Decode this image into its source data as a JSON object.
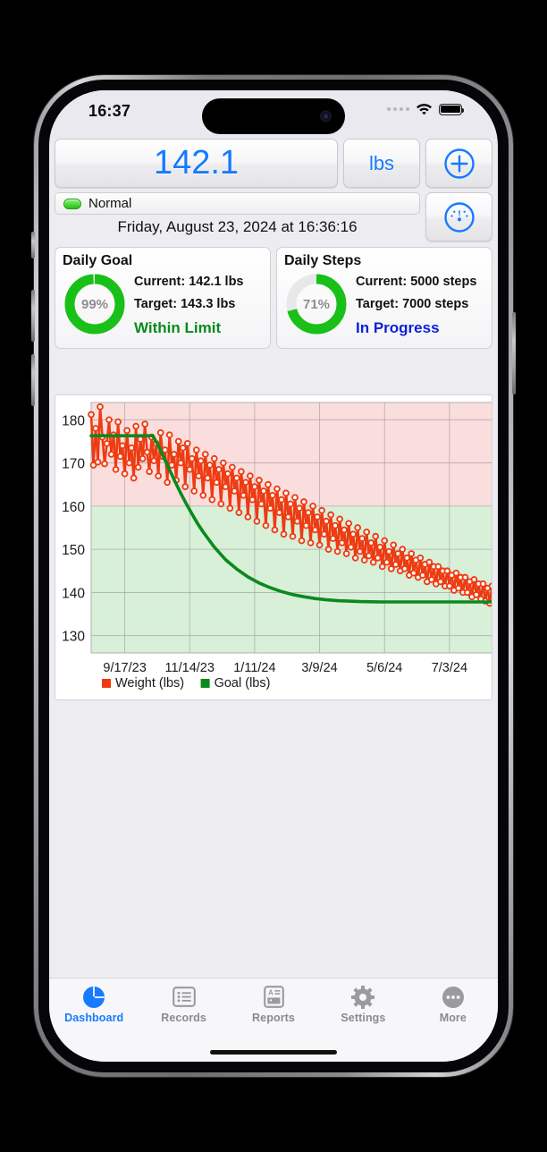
{
  "status_bar": {
    "time": "16:37",
    "signal_icon": "signal-dots-icon",
    "wifi_icon": "wifi-icon",
    "battery_icon": "battery-full-icon"
  },
  "header": {
    "weight_value": "142.1",
    "unit_label": "lbs",
    "add_icon": "plus-circle-icon",
    "gauge_icon": "gauge-icon",
    "status_label": "Normal",
    "status_color": "#21c215",
    "timestamp": "Friday, August 23, 2024 at 16:36:16"
  },
  "cards": [
    {
      "title": "Daily Goal",
      "percent_label": "99%",
      "percent_value": 99,
      "current": "Current: 142.1 lbs",
      "target": "Target: 143.3 lbs",
      "status": "Within Limit",
      "status_color": "#0a8a1e",
      "ring_color": "#18c018"
    },
    {
      "title": "Daily Steps",
      "percent_label": "71%",
      "percent_value": 71,
      "current": "Current: 5000 steps",
      "target": "Target: 7000 steps",
      "status": "In Progress",
      "status_color": "#1020d8",
      "ring_color": "#18c018"
    }
  ],
  "chart_data": {
    "type": "scatter",
    "title": "",
    "xlabel": "",
    "ylabel": "",
    "ylim": [
      126,
      184
    ],
    "xlim": [
      0,
      360
    ],
    "yticks": [
      130,
      140,
      150,
      160,
      170,
      180
    ],
    "xticks": [
      30,
      88,
      146,
      204,
      262,
      320
    ],
    "xticklabels": [
      "9/17/23",
      "11/14/23",
      "1/11/24",
      "3/9/24",
      "5/6/24",
      "7/3/24"
    ],
    "grid": true,
    "legend": [
      {
        "label": "Weight (lbs)",
        "color": "#ee3b11"
      },
      {
        "label": "Goal (lbs)",
        "color": "#0a8a1e"
      }
    ],
    "zones": [
      {
        "name": "above-limit",
        "from": 160,
        "to": 184,
        "color": "#fadddd"
      },
      {
        "name": "within-limit",
        "from": 126,
        "to": 160,
        "color": "#d8efd8"
      }
    ],
    "series": [
      {
        "name": "Weight (lbs)",
        "type": "scatter",
        "color": "#ee3b11",
        "marker": "open-circle",
        "x": [
          0,
          2,
          4,
          6,
          8,
          10,
          12,
          14,
          16,
          18,
          20,
          22,
          24,
          26,
          28,
          30,
          32,
          34,
          36,
          38,
          40,
          42,
          44,
          46,
          48,
          50,
          52,
          54,
          56,
          58,
          60,
          62,
          64,
          66,
          68,
          70,
          72,
          74,
          76,
          78,
          80,
          82,
          84,
          86,
          88,
          90,
          92,
          94,
          96,
          98,
          100,
          102,
          104,
          106,
          108,
          110,
          112,
          114,
          116,
          118,
          120,
          122,
          124,
          126,
          128,
          130,
          132,
          134,
          136,
          138,
          140,
          142,
          144,
          146,
          148,
          150,
          152,
          154,
          156,
          158,
          160,
          162,
          164,
          166,
          168,
          170,
          172,
          174,
          176,
          178,
          180,
          182,
          184,
          186,
          188,
          190,
          192,
          194,
          196,
          198,
          200,
          202,
          204,
          206,
          208,
          210,
          212,
          214,
          216,
          218,
          220,
          222,
          224,
          226,
          228,
          230,
          232,
          234,
          236,
          238,
          240,
          242,
          244,
          246,
          248,
          250,
          252,
          254,
          256,
          258,
          260,
          262,
          264,
          266,
          268,
          270,
          272,
          274,
          276,
          278,
          280,
          282,
          284,
          286,
          288,
          290,
          292,
          294,
          296,
          298,
          300,
          302,
          304,
          306,
          308,
          310,
          312,
          314,
          316,
          318,
          320,
          322,
          324,
          326,
          328,
          330,
          332,
          334,
          336,
          338,
          340,
          342,
          344,
          346,
          348,
          350,
          352,
          354,
          356,
          358
        ],
        "y": [
          181.2,
          169.5,
          178.0,
          170.2,
          183.0,
          176.0,
          169.8,
          174.5,
          180.0,
          172.0,
          176.5,
          168.5,
          179.5,
          171.5,
          174.0,
          167.5,
          177.5,
          170.0,
          173.5,
          166.5,
          178.5,
          169.0,
          175.5,
          171.0,
          179.0,
          172.5,
          168.0,
          176.0,
          170.5,
          174.5,
          167.0,
          177.0,
          171.5,
          173.0,
          165.5,
          176.5,
          169.5,
          172.0,
          166.0,
          175.0,
          170.0,
          173.5,
          164.5,
          174.5,
          168.5,
          171.0,
          163.5,
          173.0,
          167.0,
          170.5,
          162.5,
          172.0,
          166.5,
          169.5,
          161.5,
          171.0,
          165.5,
          168.5,
          160.5,
          170.0,
          164.5,
          167.5,
          159.5,
          169.0,
          163.5,
          166.5,
          158.5,
          168.0,
          162.5,
          165.5,
          157.5,
          167.0,
          161.5,
          164.5,
          156.5,
          166.0,
          160.5,
          163.5,
          155.5,
          165.0,
          159.5,
          162.5,
          154.5,
          164.0,
          158.5,
          161.5,
          153.5,
          163.0,
          157.5,
          160.5,
          153.0,
          162.0,
          156.5,
          159.5,
          152.0,
          161.0,
          155.5,
          158.5,
          151.5,
          160.0,
          154.5,
          157.5,
          151.0,
          159.0,
          153.5,
          156.5,
          150.0,
          158.0,
          152.5,
          155.5,
          149.5,
          157.0,
          151.5,
          154.5,
          149.0,
          156.0,
          150.5,
          153.5,
          148.0,
          155.0,
          149.5,
          152.5,
          147.5,
          154.0,
          148.5,
          151.5,
          147.0,
          153.0,
          148.0,
          150.5,
          146.0,
          152.0,
          147.0,
          149.5,
          145.5,
          151.0,
          146.5,
          149.0,
          145.0,
          150.0,
          145.5,
          148.0,
          144.0,
          149.0,
          144.5,
          147.5,
          143.5,
          148.0,
          144.0,
          146.5,
          142.5,
          147.0,
          143.0,
          146.0,
          142.0,
          146.0,
          142.5,
          145.0,
          141.5,
          145.0,
          141.5,
          144.0,
          140.5,
          144.5,
          141.0,
          143.5,
          140.0,
          143.5,
          140.0,
          142.5,
          139.0,
          143.0,
          139.5,
          142.0,
          138.5,
          142.0,
          138.0,
          141.0,
          137.5,
          141.5,
          137.5,
          140.5,
          136.5,
          140.5,
          136.0,
          139.5,
          135.0,
          140.0,
          135.5,
          139.0,
          134.0,
          139.0,
          134.0,
          138.0,
          133.0,
          138.5,
          133.5,
          137.0,
          132.0,
          137.5,
          132.5,
          136.0,
          131.0,
          136.5,
          131.5,
          135.0,
          130.0,
          142.1
        ]
      },
      {
        "name": "Goal (lbs)",
        "type": "line",
        "color": "#0a8a1e",
        "x": [
          0,
          10,
          20,
          30,
          40,
          50,
          55,
          60,
          65,
          70,
          75,
          80,
          85,
          90,
          95,
          100,
          110,
          120,
          130,
          140,
          150,
          160,
          170,
          180,
          190,
          200,
          210,
          220,
          230,
          240,
          250,
          260,
          270,
          280,
          290,
          300,
          310,
          320,
          330,
          340,
          350,
          360
        ],
        "y": [
          176.3,
          176.3,
          176.3,
          176.3,
          176.3,
          176.3,
          176.3,
          174.0,
          171.2,
          168.4,
          165.6,
          163.0,
          160.5,
          158.2,
          156.0,
          154.0,
          150.5,
          147.6,
          145.4,
          143.6,
          142.2,
          141.1,
          140.2,
          139.5,
          139.0,
          138.6,
          138.3,
          138.1,
          138.0,
          137.9,
          137.85,
          137.8,
          137.8,
          137.8,
          137.8,
          137.8,
          137.8,
          137.8,
          137.8,
          137.8,
          137.8,
          137.8
        ]
      }
    ]
  },
  "tab_bar": {
    "items": [
      {
        "label": "Dashboard",
        "icon": "pie-chart-icon",
        "active": true
      },
      {
        "label": "Records",
        "icon": "list-icon",
        "active": false
      },
      {
        "label": "Reports",
        "icon": "report-icon",
        "active": false
      },
      {
        "label": "Settings",
        "icon": "gear-icon",
        "active": false
      },
      {
        "label": "More",
        "icon": "ellipsis-icon",
        "active": false
      }
    ]
  }
}
